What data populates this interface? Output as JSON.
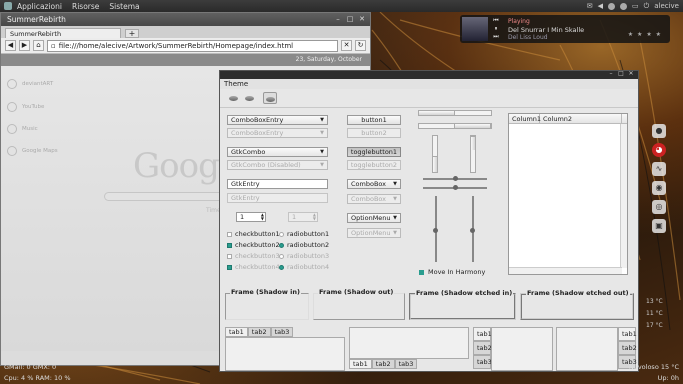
{
  "top_panel": {
    "menus": [
      "Applicazioni",
      "Risorse",
      "Sistema"
    ],
    "user": "alecive"
  },
  "media_widget": {
    "line1": "Playing",
    "artist_album": "Del Snurrar I Min Skalle",
    "track": "Del Liss Loud",
    "rating": "★ ★ ★ ★"
  },
  "browser": {
    "title": "SummerRebirth",
    "tab_label": "SummerRebirth",
    "new_tab": "+",
    "url": "file:///home/alecive/Artwork/SummerRebirth/Homepage/index.html",
    "date_strip": "23, Saturday, October",
    "side_items": [
      "deviantART",
      "YouTube",
      "Music",
      "Google Maps"
    ],
    "logo_text": "Googl",
    "search_hint": "Time"
  },
  "theme": {
    "menu": "Theme",
    "combo_entry": "ComboBoxEntry",
    "combo_entry_dis": "ComboBoxEntry",
    "gtk_combo": "GtkCombo",
    "gtk_combo_dis": "GtkCombo (Disabled)",
    "gtk_entry": "GtkEntry",
    "gtk_entry_dis": "GtkEntry",
    "spin1": "1",
    "spin2": "1",
    "checks": [
      {
        "label": "checkbutton1",
        "on": false,
        "dis": false
      },
      {
        "label": "checkbutton2",
        "on": true,
        "dis": false
      },
      {
        "label": "checkbutton3",
        "on": false,
        "dis": true
      },
      {
        "label": "checkbutton4",
        "on": true,
        "dis": true
      }
    ],
    "radios": [
      {
        "label": "radiobutton1",
        "on": false,
        "dis": false
      },
      {
        "label": "radiobutton2",
        "on": true,
        "dis": false
      },
      {
        "label": "radiobutton3",
        "on": false,
        "dis": true
      },
      {
        "label": "radiobutton4",
        "on": true,
        "dis": true
      }
    ],
    "button1": "button1",
    "button2": "button2",
    "toggle1": "togglebutton1",
    "toggle2": "togglebutton2",
    "combobox": "ComboBox",
    "combobox_dis": "ComboBox",
    "optionmenu": "OptionMenu",
    "optionmenu_dis": "OptionMenu",
    "move_in_harmony": "Move In Harmony",
    "tree_columns": [
      "Column1",
      "Column2"
    ],
    "frames": [
      "Frame (Shadow in)",
      "Frame (Shadow out)",
      "Frame (Shadow etched in)",
      "Frame (Shadow etched out)"
    ],
    "tabs": [
      "tab1",
      "tab2",
      "tab3"
    ]
  },
  "temps": [
    "13 °C",
    "11 °C",
    "17 °C"
  ],
  "bottom_panel": {
    "gmail": "GMail: 0  GMX: 0",
    "cpu_ram": "Cpu: 4 %      RAM: 10 %",
    "right1": "Nuvoloso 15 °C",
    "right2": "Up: 0h"
  }
}
